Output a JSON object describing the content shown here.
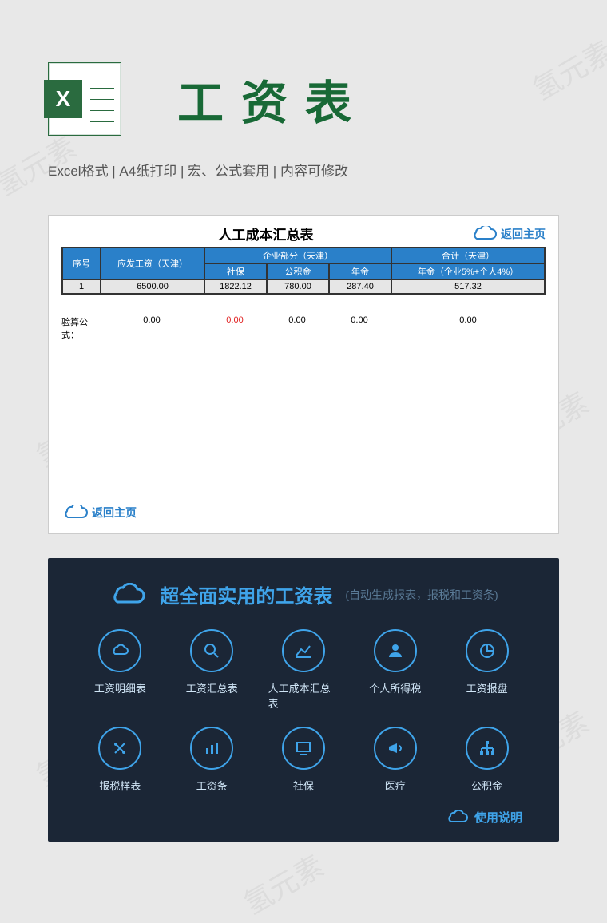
{
  "header": {
    "icon_letter": "X",
    "title": "工资表",
    "meta": "Excel格式  |   A4纸打印  |  宏、公式套用  |  内容可修改"
  },
  "sheet": {
    "title": "人工成本汇总表",
    "back_link": "返回主页",
    "head_group_enterprise": "企业部分（天津）",
    "head_group_total": "合计（天津）",
    "columns": {
      "seq": "序号",
      "salary": "应发工资（天津）",
      "shebao": "社保",
      "gjj": "公积金",
      "nianjin": "年金",
      "total_sub": "年金（企业5%+个人4%）"
    },
    "row": {
      "seq": "1",
      "salary": "6500.00",
      "shebao": "1822.12",
      "gjj": "780.00",
      "nianjin": "287.40",
      "total": "517.32"
    },
    "verify_label": "验算公式：",
    "verify": {
      "salary": "0.00",
      "shebao": "0.00",
      "gjj": "0.00",
      "nianjin": "0.00",
      "total": "0.00"
    }
  },
  "dark": {
    "title": "超全面实用的工资表",
    "sub": "(自动生成报表，报税和工资条)",
    "buttons": [
      "工资明细表",
      "工资汇总表",
      "人工成本汇总表",
      "个人所得税",
      "工资报盘",
      "报税样表",
      "工资条",
      "社保",
      "医疗",
      "公积金"
    ],
    "footer": "使用说明"
  },
  "watermark": "氢元素"
}
